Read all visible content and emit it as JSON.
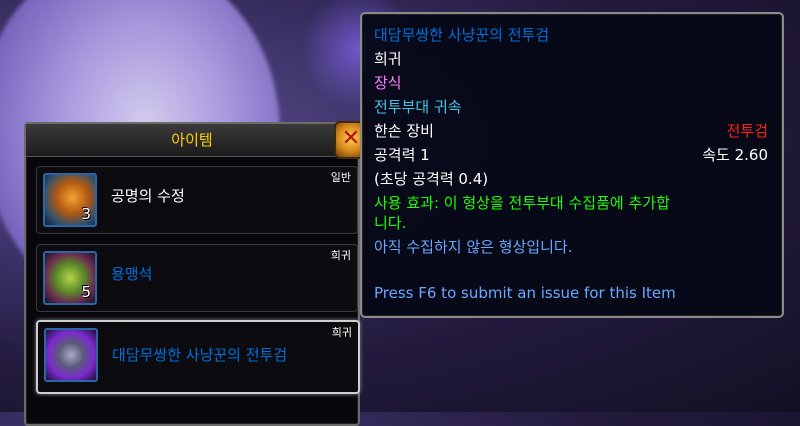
{
  "colors": {
    "title_gold": "#ffd100",
    "rare_blue": "#0070dd",
    "pink": "#ff80ff",
    "cyan": "#40c7eb",
    "green": "#1eff00",
    "red": "#ff2020",
    "tip_blue": "#6aa8ff"
  },
  "panel": {
    "title": "아이템",
    "close_icon": "close-icon",
    "items": [
      {
        "name": "공명의 수정",
        "rarity": "일반",
        "count": "3",
        "icon": "crystal-icon"
      },
      {
        "name": "용맹석",
        "rarity": "희귀",
        "count": "5",
        "icon": "stone-icon"
      },
      {
        "name": "대담무쌍한 사냥꾼의 전투검",
        "rarity": "희귀",
        "count": "",
        "icon": "warglaive-icon"
      }
    ]
  },
  "tooltip": {
    "item_name": "대담무쌍한 사냥꾼의 전투검",
    "quality": "희귀",
    "type": "장식",
    "binding": "전투부대 귀속",
    "slot": "한손 장비",
    "weapon_type": "전투검",
    "damage": "공격력 1",
    "speed": "속도 2.60",
    "dps": "(초당 공격력 0.4)",
    "use_effect_line1": "사용 효과: 이 형상을 전투부대 수집품에 추가합",
    "use_effect_line2": "니다.",
    "collection_note": "아직 수집하지 않은 형상입니다.",
    "submit_hint": "Press F6 to submit an issue for this Item"
  }
}
